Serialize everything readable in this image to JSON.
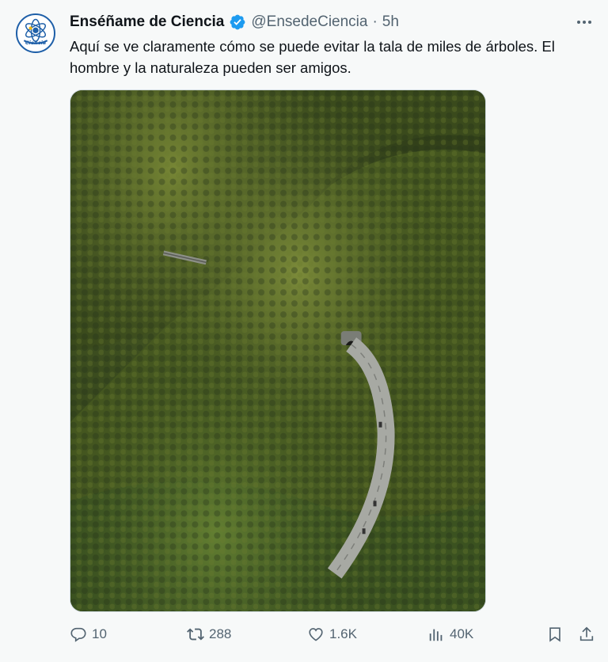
{
  "author": {
    "display_name": "Enséñame de Ciencia",
    "handle": "@EnsedeCiencia",
    "separator": "·",
    "time": "5h",
    "avatar_text": "Ciencia"
  },
  "tweet": {
    "text": "Aquí se ve claramente cómo se puede evitar la tala de miles de árboles. El hombre y la naturaleza pueden ser amigos."
  },
  "media": {
    "description_icon": "image"
  },
  "actions": {
    "replies": "10",
    "retweets": "288",
    "likes": "1.6K",
    "views": "40K"
  },
  "colors": {
    "text_primary": "#0f1419",
    "text_secondary": "#536471",
    "verified": "#1d9bf0",
    "background": "#f7f9f9"
  }
}
